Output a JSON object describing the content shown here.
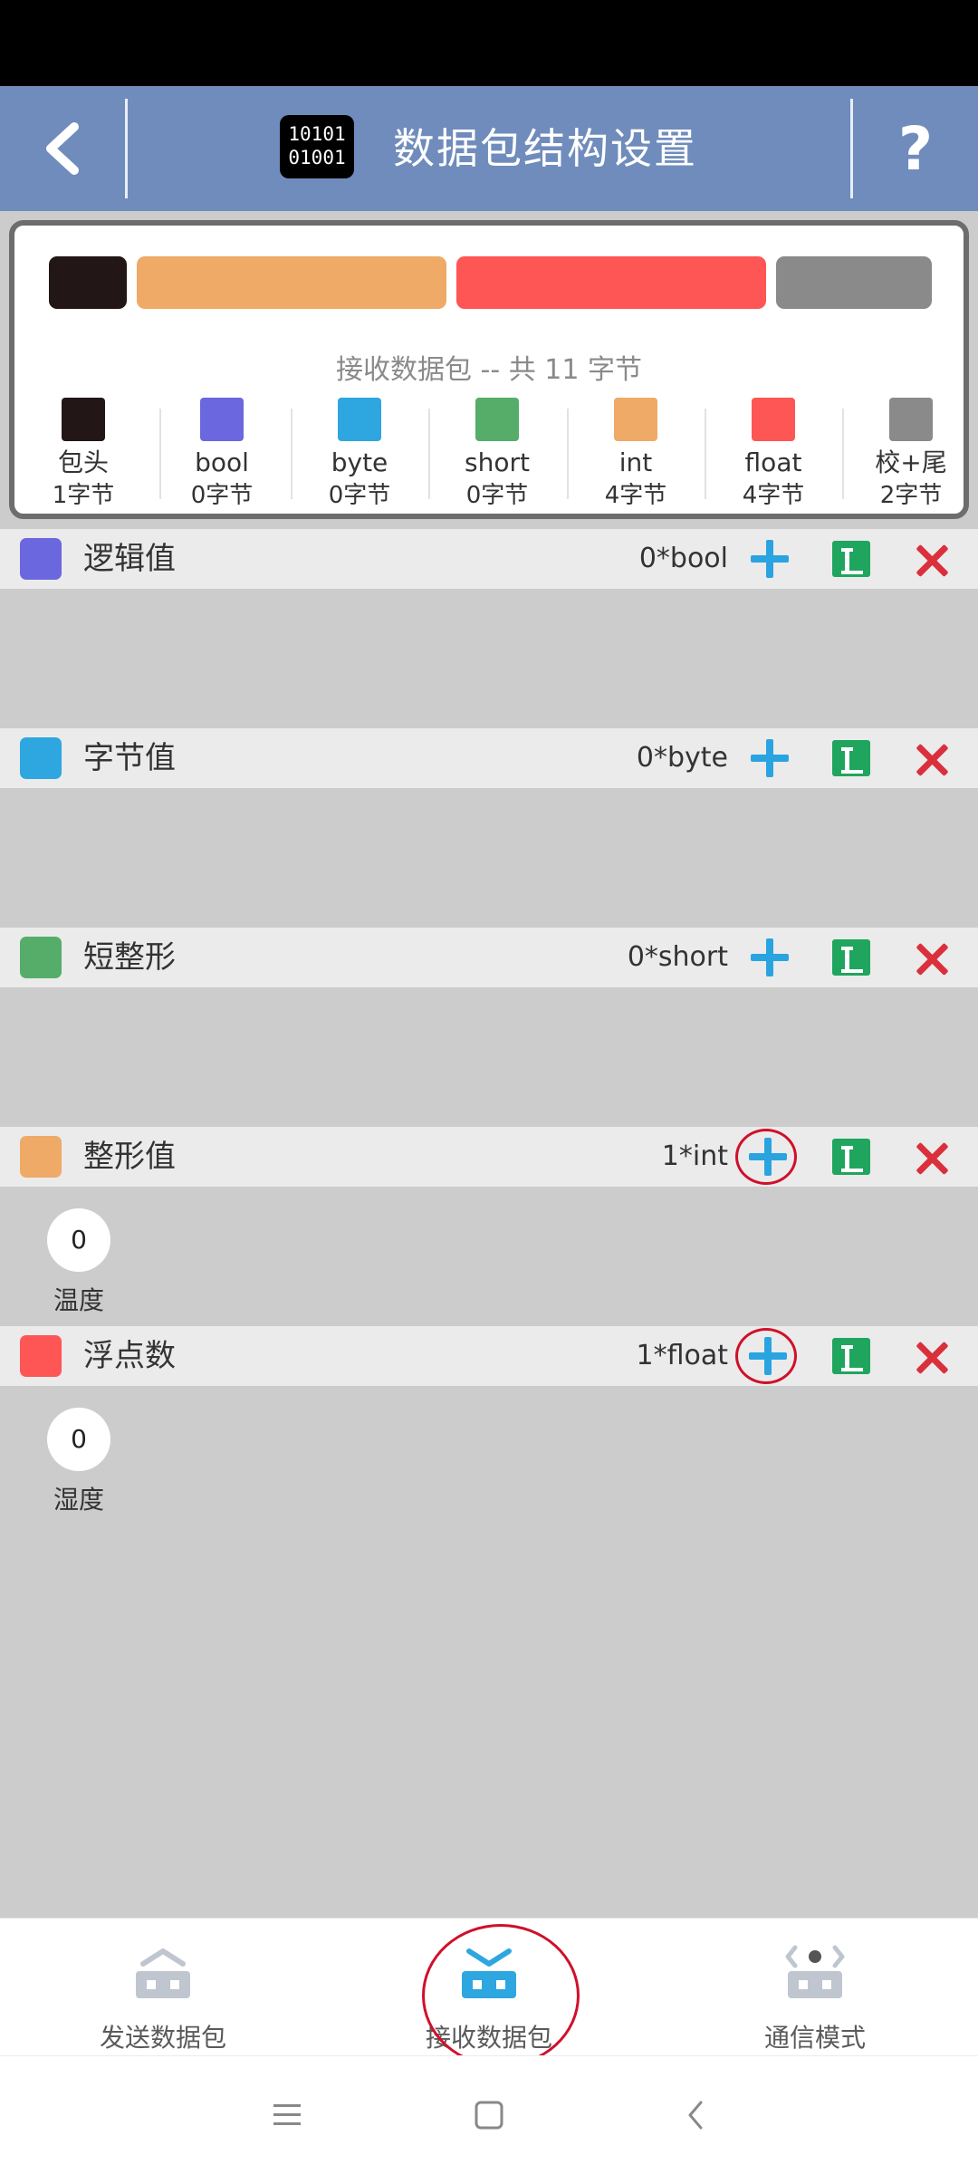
{
  "header": {
    "title": "数据包结构设置",
    "logo_line1": "10101",
    "logo_line2": "01001",
    "help": "?"
  },
  "summary": {
    "caption": "接收数据包 -- 共 11 字节",
    "legend": [
      {
        "name": "包头",
        "bytes": "1字节",
        "color": "#231616"
      },
      {
        "name": "bool",
        "bytes": "0字节",
        "color": "#6b67de"
      },
      {
        "name": "byte",
        "bytes": "0字节",
        "color": "#2ea6e0"
      },
      {
        "name": "short",
        "bytes": "0字节",
        "color": "#56ad69"
      },
      {
        "name": "int",
        "bytes": "4字节",
        "color": "#eeaa66"
      },
      {
        "name": "float",
        "bytes": "4字节",
        "color": "#fe5555"
      },
      {
        "name": "校+尾",
        "bytes": "2字节",
        "color": "#8a8a8a"
      }
    ]
  },
  "sections": [
    {
      "name": "逻辑值",
      "count": "0*bool",
      "color": "#6b67de"
    },
    {
      "name": "字节值",
      "count": "0*byte",
      "color": "#2ea6e0"
    },
    {
      "name": "短整形",
      "count": "0*short",
      "color": "#56ad69"
    },
    {
      "name": "整形值",
      "count": "1*int",
      "color": "#eeaa66",
      "field": {
        "value": "0",
        "label": "温度"
      }
    },
    {
      "name": "浮点数",
      "count": "1*float",
      "color": "#fe5555",
      "field": {
        "value": "0",
        "label": "湿度"
      }
    }
  ],
  "bottom_nav": [
    {
      "label": "发送数据包",
      "icon": "send-packet-icon"
    },
    {
      "label": "接收数据包",
      "icon": "receive-packet-icon",
      "active": true
    },
    {
      "label": "通信模式",
      "icon": "comm-mode-icon"
    }
  ],
  "colors": {
    "accent": "#2ea6e0",
    "header": "#6f8cbc",
    "delete": "#d9303c",
    "edit": "#20a55e"
  }
}
